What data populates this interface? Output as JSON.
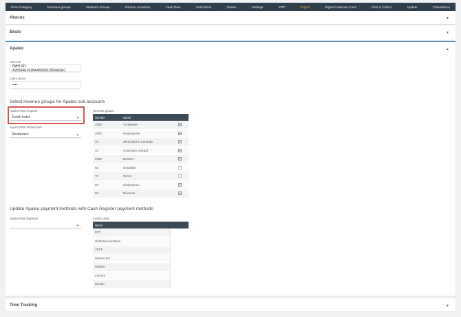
{
  "nav": [
    "Price Category",
    "Revenue groups",
    "Statistics Groups",
    "Kitchen Locations",
    "Cash Flow",
    "Cash Book",
    "Scales",
    "Settings",
    "ERP",
    "Export",
    "Digital Customer Card",
    "Click & Collect",
    "Update",
    "Translations"
  ],
  "nav_active": "Export",
  "panels": {
    "abacus": "Abacus",
    "besio": "Besio",
    "apaleo": "Apaleo",
    "time": "Time Tracking"
  },
  "apaleo": {
    "client_id_label": "Client ID",
    "client_id_value": "IWHI-SP-A25694E161BA4656B135D4A2EC",
    "client_secret_label": "Client secret",
    "client_secret_value": "••••",
    "revenue_section_title": "Select revenue groups for Apaleo sub-accounts",
    "pms_property_label": "Apaleo PMS Property",
    "pms_property_value": "Zurich hotel",
    "pms_subaccount_label": "Apaleo PMS Subaccount",
    "pms_subaccount_value": "Restaurant",
    "revenue_groups_label": "Revenue groups",
    "revenue_table": {
      "headers": [
        "Number",
        "Name"
      ],
      "rows": [
        {
          "number": "1000",
          "name": "Vorspeisen",
          "checked": true
        },
        {
          "number": "3000",
          "name": "Hauptspeise",
          "checked": true
        },
        {
          "number": "30",
          "name": "alkoholische Getränke",
          "checked": true
        },
        {
          "number": "40",
          "name": "Gutschein Verkauf",
          "checked": true
        },
        {
          "number": "2000",
          "name": "Dessert",
          "checked": true
        },
        {
          "number": "60",
          "name": "Getränke",
          "checked": false
        },
        {
          "number": "70",
          "name": "Weine",
          "checked": false
        },
        {
          "number": "80",
          "name": "Kindermenu",
          "checked": true
        },
        {
          "number": "90",
          "name": "Diverses",
          "checked": true
        }
      ]
    },
    "payment_section_title": "Update Apaleo payment methods with Cash Register payment methods",
    "pms_payment_label": "Apaleo PMS Payment",
    "pms_payment_value": "",
    "credit_cards_label": "Credit Cards",
    "credit_table": {
      "header": "Name",
      "rows": [
        "EFT",
        "Gutschein einlösen",
        "TEST",
        "Mastercard",
        "Gutado",
        "e-guma",
        "gurado"
      ]
    }
  },
  "colors": {
    "nav_bg": "#2f3e4b",
    "nav_active": "#f0b429",
    "table_header": "#3b4a57",
    "highlight": "#d9534f",
    "apaleo_border": "#4b8fbf"
  }
}
